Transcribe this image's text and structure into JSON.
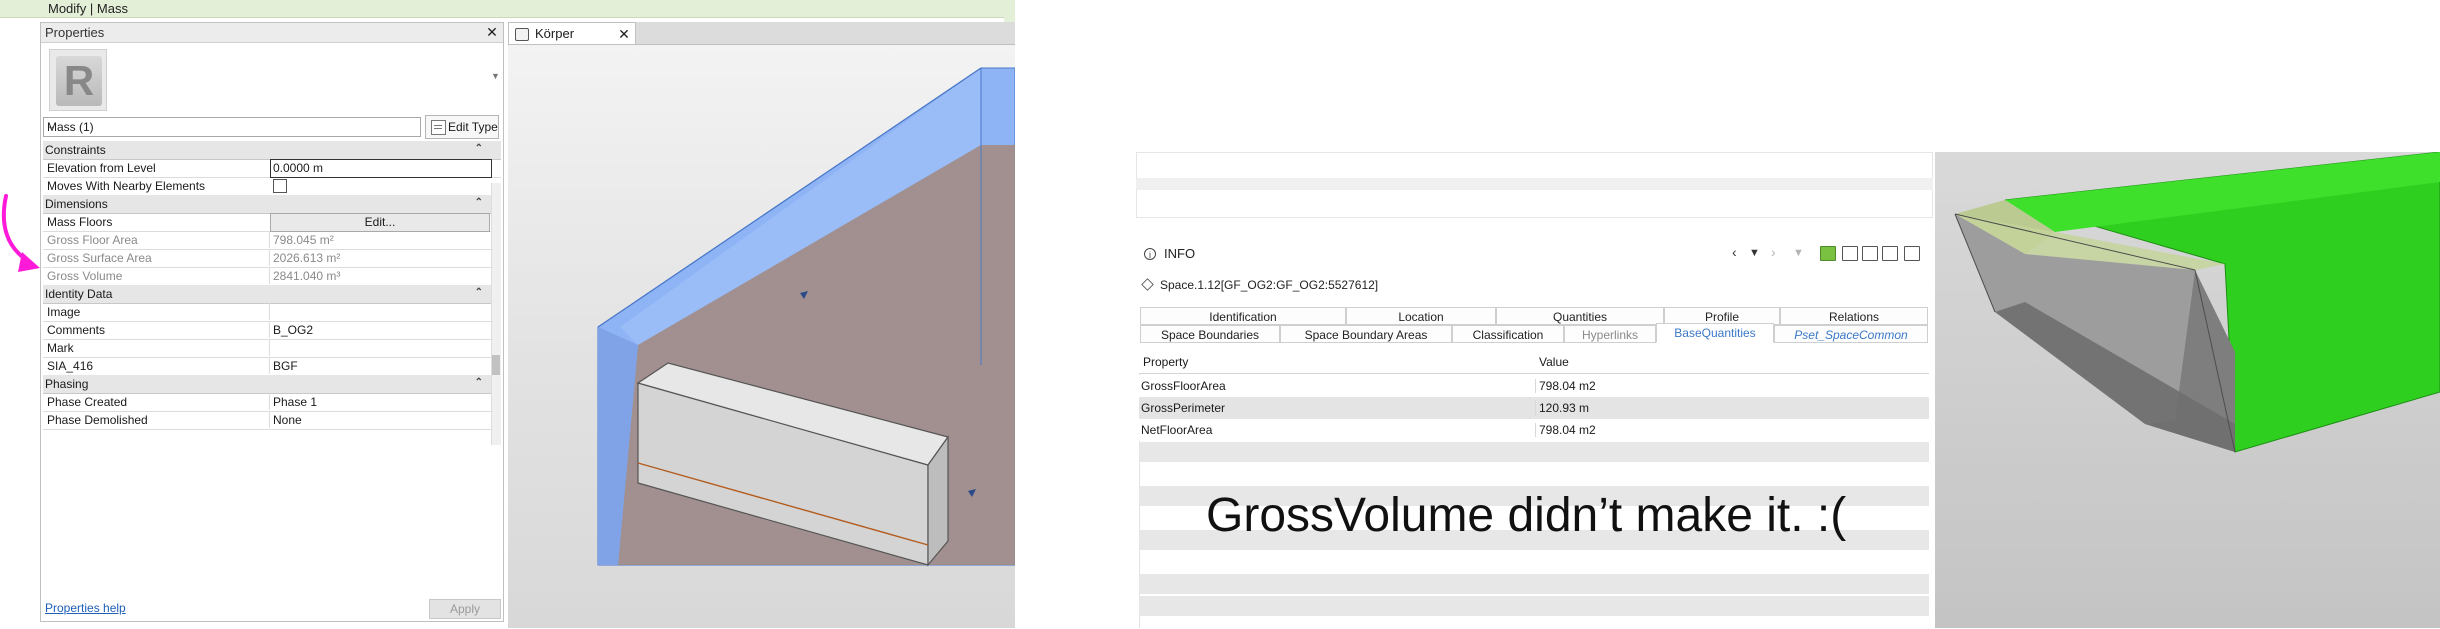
{
  "revit": {
    "ribbon_title": "Modify | Mass",
    "properties": {
      "panel_title": "Properties",
      "close_glyph": "✕",
      "type_image_letter": "R",
      "type_selector": "Mass (1)",
      "edit_type_label": "Edit Type",
      "groups": {
        "constraints": "Constraints",
        "dimensions": "Dimensions",
        "identity": "Identity Data",
        "phasing": "Phasing"
      },
      "rows": {
        "elevation_from_level": {
          "name": "Elevation from Level",
          "value": "0.0000 m"
        },
        "moves_with_nearby": {
          "name": "Moves With Nearby Elements",
          "checked": false
        },
        "mass_floors": {
          "name": "Mass Floors",
          "button": "Edit..."
        },
        "gross_floor_area": {
          "name": "Gross Floor Area",
          "value": "798.045 m²"
        },
        "gross_surface_area": {
          "name": "Gross Surface Area",
          "value": "2026.613 m²"
        },
        "gross_volume": {
          "name": "Gross Volume",
          "value": "2841.040 m³"
        },
        "image": {
          "name": "Image",
          "value": ""
        },
        "comments": {
          "name": "Comments",
          "value": "B_OG2"
        },
        "mark": {
          "name": "Mark",
          "value": ""
        },
        "sia_416": {
          "name": "SIA_416",
          "value": "BGF"
        },
        "phase_created": {
          "name": "Phase Created",
          "value": "Phase 1"
        },
        "phase_demolished": {
          "name": "Phase Demolished",
          "value": "None"
        }
      },
      "help_link": "Properties help",
      "apply_label": "Apply"
    },
    "view_tab": {
      "label": "Körper",
      "close_glyph": "✕"
    },
    "colors": {
      "annotation_arrow": "#ff1ad9",
      "mass_blue": "#8fb4f5",
      "mass_brown": "#a58a7c"
    }
  },
  "viewer": {
    "info_title": "INFO",
    "entity": "Space.1.12[GF_OG2:GF_OG2:5527612]",
    "tabs_row1": [
      "Identification",
      "Location",
      "Quantities",
      "Profile",
      "Relations"
    ],
    "tabs_row2": [
      "Space Boundaries",
      "Space Boundary Areas",
      "Classification",
      "Hyperlinks",
      "BaseQuantities",
      "Pset_SpaceCommon"
    ],
    "active_tab": "BaseQuantities",
    "table": {
      "headers": [
        "Property",
        "Value"
      ],
      "rows": [
        [
          "GrossFloorArea",
          "798.04 m2"
        ],
        [
          "GrossPerimeter",
          "120.93 m"
        ],
        [
          "NetFloorArea",
          "798.04 m2"
        ]
      ]
    },
    "caption": "GrossVolume didn’t make it. :(",
    "colors": {
      "viewer_green": "#2fcf1f",
      "viewer_grey": "#8a8a8a"
    }
  }
}
